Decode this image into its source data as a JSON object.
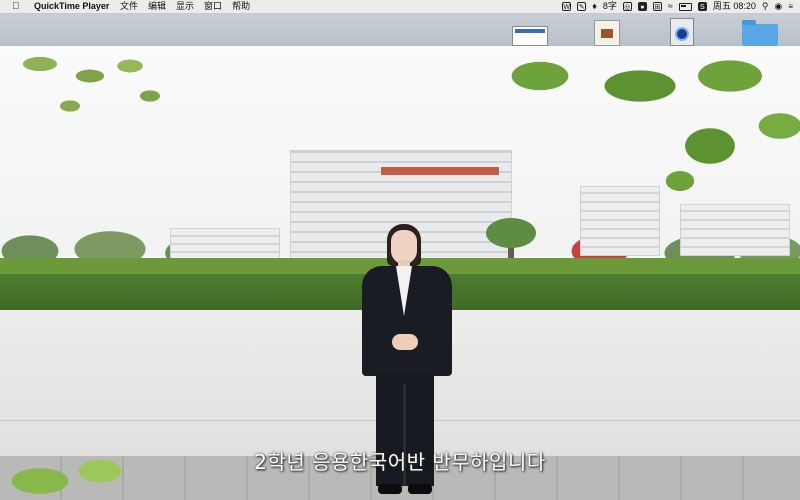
{
  "menubar": {
    "apple_icon": "apple-logo-icon",
    "app_name": "QuickTime Player",
    "menus": [
      "文件",
      "编辑",
      "显示",
      "窗口",
      "帮助"
    ],
    "status": {
      "input_method": "8",
      "input_suffix": "字",
      "weekday": "周五",
      "time": "08:20"
    }
  },
  "video": {
    "subtitle": "2학년 응용한국어반  반무하입니다"
  },
  "colors": {
    "menubar_bg": "#ececec",
    "subtitle": "#ffffff"
  }
}
